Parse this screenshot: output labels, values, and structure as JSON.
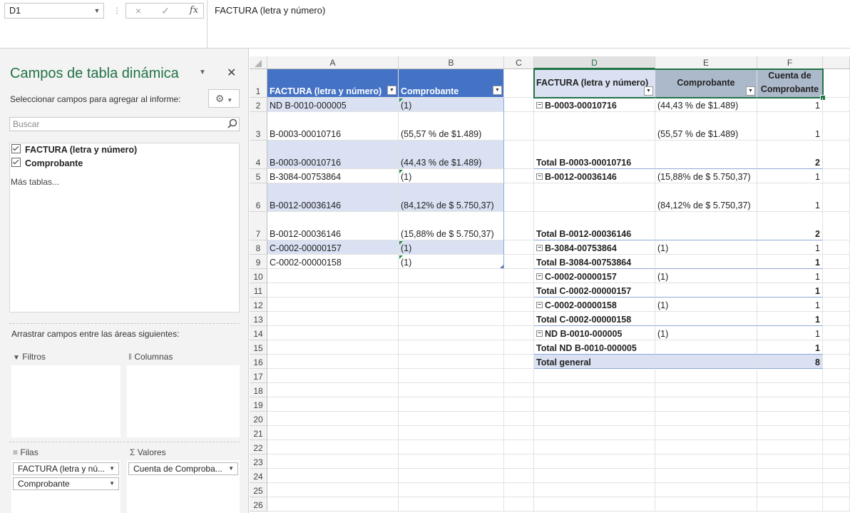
{
  "formula_bar": {
    "name_box": "D1",
    "cancel_icon": "×",
    "enter_icon": "✓",
    "fx_label": "fx",
    "formula": "FACTURA (letra y número)"
  },
  "pivot_pane": {
    "title": "Campos de tabla dinámica",
    "subtitle": "Seleccionar campos para agregar al informe:",
    "search_placeholder": "Buscar",
    "fields": [
      "FACTURA (letra y número)",
      "Comprobante"
    ],
    "more_tables": "Más tablas...",
    "drag_label": "Arrastrar campos entre las áreas siguientes:",
    "areas": {
      "filters": "Filtros",
      "columns": "Columnas",
      "rows": "Filas",
      "values": "Valores"
    },
    "rows_fields": [
      "FACTURA (letra y nú...",
      "Comprobante"
    ],
    "values_fields": [
      "Cuenta de Comproba..."
    ]
  },
  "grid": {
    "columns": [
      "A",
      "B",
      "C",
      "D",
      "E",
      "F"
    ],
    "rows": [
      "1",
      "2",
      "3",
      "4",
      "5",
      "6",
      "7",
      "8",
      "9",
      "10",
      "11",
      "12",
      "13",
      "14",
      "15",
      "16",
      "17",
      "18",
      "19",
      "20",
      "21",
      "22",
      "23",
      "24",
      "25",
      "26"
    ],
    "table_header": [
      "FACTURA (letra y número)",
      "Comprobante"
    ],
    "table_rows": [
      [
        "ND B-0010-000005",
        "(1)"
      ],
      [
        "B-0003-00010716",
        "(55,57 % de $1.489)"
      ],
      [
        "B-0003-00010716",
        "(44,43 % de $1.489)"
      ],
      [
        "B-3084-00753864",
        "(1)"
      ],
      [
        "B-0012-00036146",
        "(84,12% de $ 5.750,37)"
      ],
      [
        "B-0012-00036146",
        "(15,88% de $ 5.750,37)"
      ],
      [
        "C-0002-00000157",
        "(1)"
      ],
      [
        "C-0002-00000158",
        "(1)"
      ]
    ],
    "pivot_header": [
      "FACTURA (letra y número)",
      "Comprobante",
      "Cuenta de",
      "Comprobante"
    ],
    "pivot_rows": [
      [
        "B-0003-00010716",
        "(44,43 % de $1.489)",
        "1"
      ],
      [
        "",
        "(55,57 % de $1.489)",
        "1"
      ],
      [
        "Total B-0003-00010716",
        "",
        "2"
      ],
      [
        "B-0012-00036146",
        "(15,88% de $ 5.750,37)",
        "1"
      ],
      [
        "",
        "(84,12% de $ 5.750,37)",
        "1"
      ],
      [
        "Total B-0012-00036146",
        "",
        "2"
      ],
      [
        "B-3084-00753864",
        "(1)",
        "1"
      ],
      [
        "Total B-3084-00753864",
        "",
        "1"
      ],
      [
        "C-0002-00000157",
        "(1)",
        "1"
      ],
      [
        "Total C-0002-00000157",
        "",
        "1"
      ],
      [
        "C-0002-00000158",
        "(1)",
        "1"
      ],
      [
        "Total C-0002-00000158",
        "",
        "1"
      ],
      [
        "ND B-0010-000005",
        "(1)",
        "1"
      ],
      [
        "Total ND B-0010-000005",
        "",
        "1"
      ],
      [
        "Total general",
        "",
        "8"
      ]
    ]
  }
}
